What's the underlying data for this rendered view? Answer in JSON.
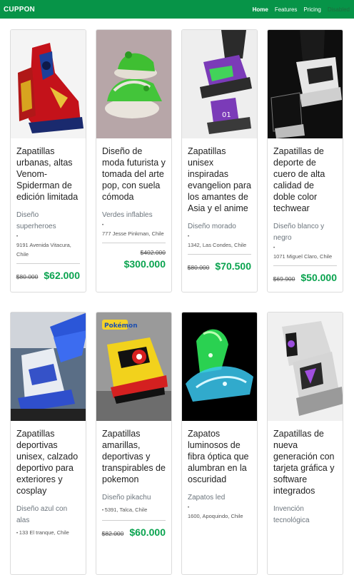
{
  "navbar": {
    "brand": "CUPPON",
    "links": [
      "Home",
      "Features",
      "Pricing",
      "Disabled"
    ]
  },
  "colors": {
    "nav_bg": "#079448",
    "price": "#0aa34f"
  },
  "products": [
    {
      "title": "Zapatillas urbanas, altas Venom-Spiderman de edición limitada",
      "subtitle": "Diseño superheroes",
      "address": "9191 Avenida Vitacura, Chile",
      "old_price": "$80.000",
      "new_price": "$62.000",
      "image": "red-blue-spiderman-sneakers"
    },
    {
      "title": "Diseño de moda futurista y tomada del arte pop, con suela cómoda",
      "subtitle": "Verdes inflables",
      "address": "777 Jesse Pinkman, Chile",
      "old_price": "$402.000",
      "new_price": "$300.000",
      "image": "green-inflatable-sneakers"
    },
    {
      "title": "Zapatillas unisex inspiradas evangelion para los amantes de Asia y el anime",
      "subtitle": "Diseño morado",
      "address": "1342, Las Condes, Chile",
      "old_price": "$80.000",
      "new_price": "$70.500",
      "image": "purple-evangelion-sneakers"
    },
    {
      "title": "Zapatillas de deporte de cuero de alta calidad de doble color techwear",
      "subtitle": "Diseño blanco y negro",
      "address": "1071 Miguel Claro, Chile",
      "old_price": "$69.900",
      "new_price": "$50.000",
      "image": "black-white-techwear-sneakers"
    },
    {
      "title": "Zapatillas deportivas unisex, calzado deportivo para exteriores y cosplay",
      "subtitle": "Diseño azul con alas",
      "address": "133 El tranque, Chile",
      "old_price": "",
      "new_price": "",
      "image": "blue-winged-sneakers"
    },
    {
      "title": "Zapatillas amarillas, deportivas y transpirables de pokemon",
      "subtitle": "Diseño pikachu",
      "address": "5391, Talca, Chile",
      "old_price": "$82.000",
      "new_price": "$60.000",
      "image": "yellow-pokemon-sneakers"
    },
    {
      "title": "Zapatos luminosos de fibra óptica que alumbran en la oscuridad",
      "subtitle": "Zapatos led",
      "address": "1600, Apoquindo, Chile",
      "old_price": "",
      "new_price": "",
      "image": "led-glowing-sneakers"
    },
    {
      "title": "Zapatillas de nueva generación con tarjeta gráfica y software integrados",
      "subtitle": "Invención tecnológica",
      "address": "",
      "old_price": "",
      "new_price": "",
      "image": "tech-sneaker-graphics-card"
    }
  ]
}
